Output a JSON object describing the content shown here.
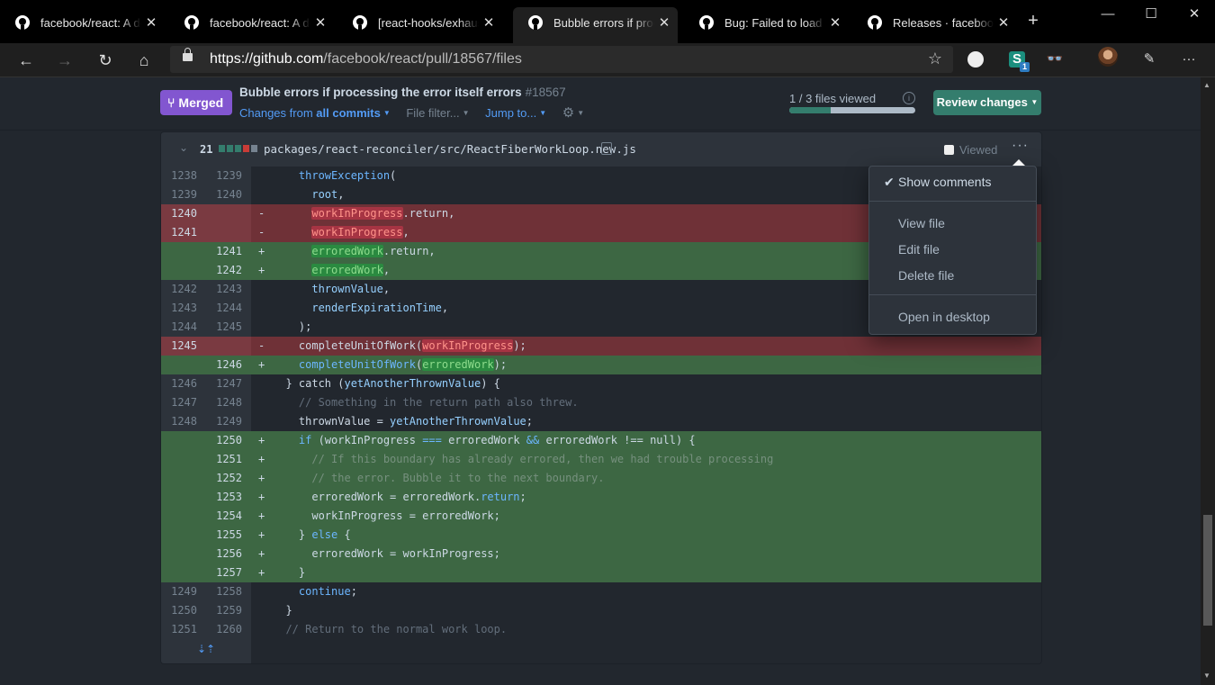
{
  "browser": {
    "tabs": [
      {
        "title": "facebook/react: A declarative",
        "active": false
      },
      {
        "title": "facebook/react: A declarative",
        "active": false
      },
      {
        "title": "[react-hooks/exhaustive-deps]",
        "active": false
      },
      {
        "title": "Bubble errors if processing",
        "active": true
      },
      {
        "title": "Bug: Failed to load config",
        "active": false
      },
      {
        "title": "Releases · facebook/react",
        "active": false
      }
    ],
    "new_tab": "+",
    "window": {
      "minimize": "—",
      "maximize": "☐",
      "close": "✕"
    },
    "url_host": "https://github.com",
    "url_path": "/facebook/react/pull/18567/files"
  },
  "pr": {
    "state": "Merged",
    "title": "Bubble errors if processing the error itself errors",
    "number": "#18567",
    "changes_from": "Changes from",
    "all_commits": "all commits",
    "file_filter": "File filter...",
    "jump_to": "Jump to...",
    "files_viewed": "1 / 3 files viewed",
    "viewed_fraction": 0.33,
    "review_changes": "Review changes"
  },
  "file": {
    "change_count": "21",
    "diffstat": [
      "#347d6d",
      "#347d6d",
      "#347d6d",
      "#c93c37",
      "#768390"
    ],
    "path": "packages/react-reconciler/src/ReactFiberWorkLoop.new.js",
    "viewed_label": "Viewed"
  },
  "menu": {
    "show_comments": "Show comments",
    "view_file": "View file",
    "edit_file": "Edit file",
    "delete_file": "Delete file",
    "open_desktop": "Open in desktop"
  },
  "diff": [
    {
      "t": "ctx",
      "a": "1238",
      "b": "1239",
      "s": "",
      "c": "<span class=\"k\">    throwException</span><span class=\"p\">(</span>"
    },
    {
      "t": "ctx",
      "a": "1239",
      "b": "1240",
      "s": "",
      "c": "<span class=\"v\">      root</span><span class=\"p\">,</span>"
    },
    {
      "t": "del",
      "a": "1240",
      "b": "",
      "s": "-",
      "c": "      <span class=\"hd\">workInProgress</span><span class=\"p\">.return,</span>"
    },
    {
      "t": "del",
      "a": "1241",
      "b": "",
      "s": "-",
      "c": "      <span class=\"hd\">workInProgress</span><span class=\"p\">,</span>"
    },
    {
      "t": "add",
      "a": "",
      "b": "1241",
      "s": "+",
      "c": "      <span class=\"ha\">erroredWork</span><span class=\"p\">.return,</span>"
    },
    {
      "t": "add",
      "a": "",
      "b": "1242",
      "s": "+",
      "c": "      <span class=\"ha\">erroredWork</span><span class=\"p\">,</span>"
    },
    {
      "t": "ctx",
      "a": "1242",
      "b": "1243",
      "s": "",
      "c": "<span class=\"v\">      thrownValue</span><span class=\"p\">,</span>"
    },
    {
      "t": "ctx",
      "a": "1243",
      "b": "1244",
      "s": "",
      "c": "<span class=\"v\">      renderExpirationTime</span><span class=\"p\">,</span>"
    },
    {
      "t": "ctx",
      "a": "1244",
      "b": "1245",
      "s": "",
      "c": "<span class=\"p\">    );</span>"
    },
    {
      "t": "del",
      "a": "1245",
      "b": "",
      "s": "-",
      "c": "<span class=\"p\">    completeUnitOfWork(</span><span class=\"hd\">workInProgress</span><span class=\"p\">);</span>"
    },
    {
      "t": "add",
      "a": "",
      "b": "1246",
      "s": "+",
      "c": "<span class=\"k\">    completeUnitOfWork</span><span class=\"p\">(</span><span class=\"ha\">erroredWork</span><span class=\"p\">);</span>"
    },
    {
      "t": "ctx",
      "a": "1246",
      "b": "1247",
      "s": "",
      "c": "<span class=\"p\">  } catch (</span><span class=\"v\">yetAnotherThrownValue</span><span class=\"p\">) {</span>"
    },
    {
      "t": "ctx",
      "a": "1247",
      "b": "1248",
      "s": "",
      "c": "<span class=\"cm\">    // Something in the return path also threw.</span>"
    },
    {
      "t": "ctx",
      "a": "1248",
      "b": "1249",
      "s": "",
      "c": "<span class=\"p\">    thrownValue = </span><span class=\"v\">yetAnotherThrownValue</span><span class=\"p\">;</span>"
    },
    {
      "t": "add",
      "a": "",
      "b": "1250",
      "s": "+",
      "c": "<span class=\"k\">    if</span><span class=\"p\"> (workInProgress </span><span class=\"k\">===</span><span class=\"p\"> erroredWork </span><span class=\"k\">&amp;&amp;</span><span class=\"p\"> erroredWork !== null) {</span>"
    },
    {
      "t": "add",
      "a": "",
      "b": "1251",
      "s": "+",
      "c": "<span class=\"cm dim\">      // If this boundary has already errored, then we had trouble processing</span>"
    },
    {
      "t": "add",
      "a": "",
      "b": "1252",
      "s": "+",
      "c": "<span class=\"cm dim\">      // the error. Bubble it to the next boundary.</span>"
    },
    {
      "t": "add",
      "a": "",
      "b": "1253",
      "s": "+",
      "c": "<span class=\"p\">      erroredWork = erroredWork.</span><span class=\"k\">return</span><span class=\"p\">;</span>"
    },
    {
      "t": "add",
      "a": "",
      "b": "1254",
      "s": "+",
      "c": "<span class=\"p\">      workInProgress = erroredWork;</span>"
    },
    {
      "t": "add",
      "a": "",
      "b": "1255",
      "s": "+",
      "c": "<span class=\"p\">    } </span><span class=\"k\">else</span><span class=\"p\"> {</span>"
    },
    {
      "t": "add",
      "a": "",
      "b": "1256",
      "s": "+",
      "c": "<span class=\"p\">      erroredWork = workInProgress;</span>"
    },
    {
      "t": "add",
      "a": "",
      "b": "1257",
      "s": "+",
      "c": "<span class=\"p\">    }</span>"
    },
    {
      "t": "ctx",
      "a": "1249",
      "b": "1258",
      "s": "",
      "c": "<span class=\"k\">    continue</span><span class=\"p\">;</span>"
    },
    {
      "t": "ctx",
      "a": "1250",
      "b": "1259",
      "s": "",
      "c": "<span class=\"p\">  }</span>"
    },
    {
      "t": "ctx",
      "a": "1251",
      "b": "1260",
      "s": "",
      "c": "<span class=\"cm\">  // Return to the normal work loop.</span>"
    }
  ],
  "colors": {
    "merged": "#8256d0",
    "review": "#347d6d",
    "addition": "#3d6743",
    "deletion": "#6f3137"
  }
}
